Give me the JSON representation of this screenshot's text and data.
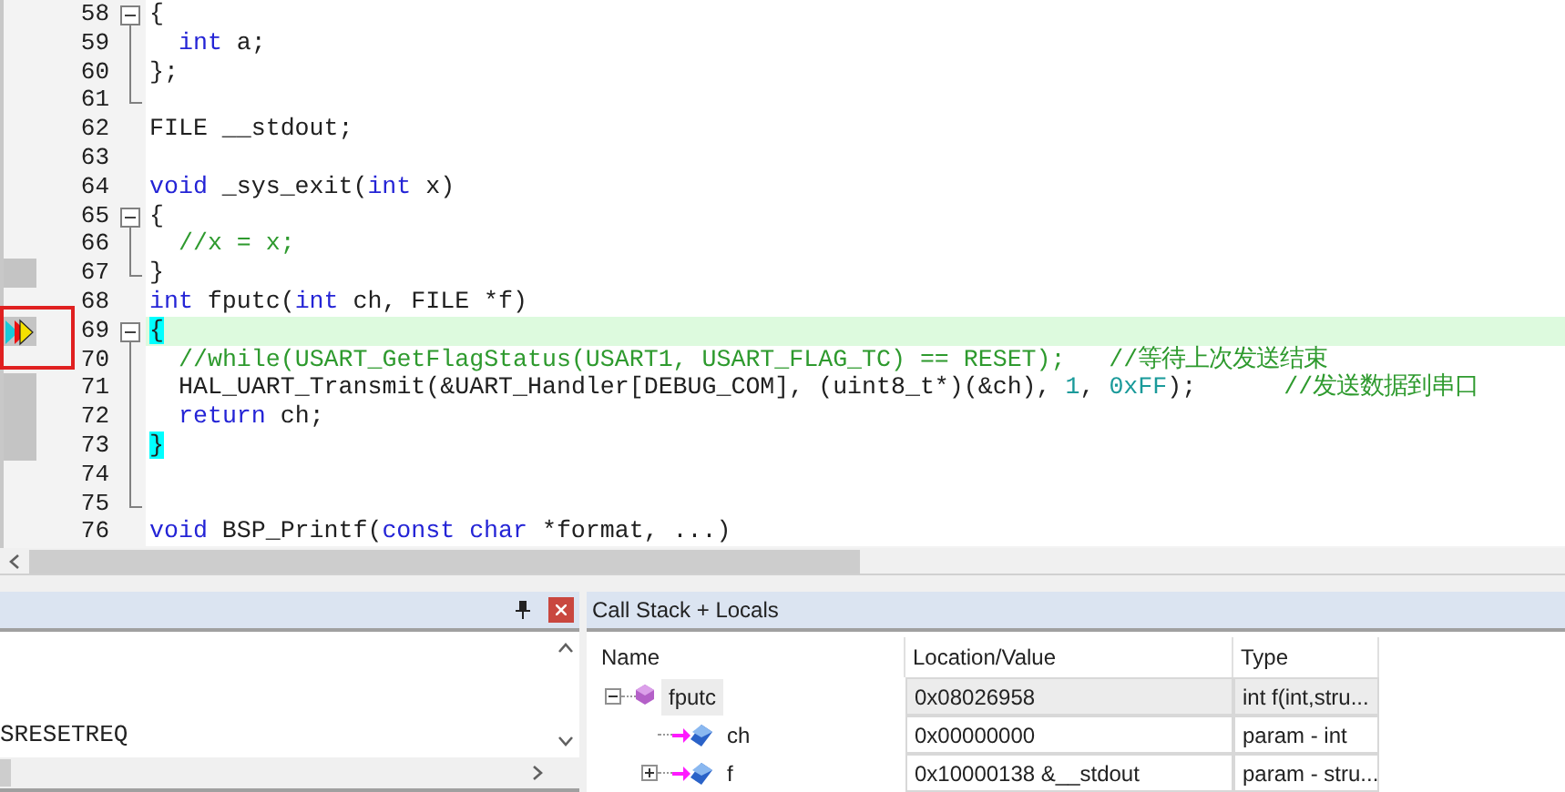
{
  "editor": {
    "lines": [
      {
        "number": "58",
        "kind": "opener",
        "marked": false,
        "current": false,
        "indented": false,
        "segments": [
          {
            "kind": "plain",
            "text": "{"
          }
        ]
      },
      {
        "number": "59",
        "kind": "inner",
        "marked": false,
        "current": false,
        "indented": true,
        "segments": [
          {
            "kind": "keyword",
            "text": "int"
          },
          {
            "kind": "plain",
            "text": " a;"
          }
        ]
      },
      {
        "number": "60",
        "kind": "inner",
        "marked": false,
        "current": false,
        "indented": false,
        "segments": [
          {
            "kind": "plain",
            "text": "};"
          }
        ]
      },
      {
        "number": "61",
        "kind": "closer",
        "marked": false,
        "current": false
      },
      {
        "number": "62",
        "kind": "plain",
        "marked": false,
        "current": false,
        "indented": false,
        "segments": [
          {
            "kind": "plain",
            "text": "FILE __stdout;"
          }
        ]
      },
      {
        "number": "63",
        "kind": "plain",
        "marked": false,
        "current": false
      },
      {
        "number": "64",
        "kind": "plain",
        "marked": false,
        "current": false,
        "indented": false,
        "segments": [
          {
            "kind": "keyword",
            "text": "void"
          },
          {
            "kind": "plain",
            "text": " _sys_exit("
          },
          {
            "kind": "keyword",
            "text": "int"
          },
          {
            "kind": "plain",
            "text": " x)"
          }
        ]
      },
      {
        "number": "65",
        "kind": "opener",
        "marked": false,
        "current": false,
        "indented": false,
        "segments": [
          {
            "kind": "plain",
            "text": "{"
          }
        ]
      },
      {
        "number": "66",
        "kind": "inner",
        "marked": false,
        "current": false,
        "indented": true,
        "segments": [
          {
            "kind": "comment",
            "text": "//x = x;"
          }
        ]
      },
      {
        "number": "67",
        "kind": "closer",
        "marked": true,
        "current": false,
        "indented": false,
        "segments": [
          {
            "kind": "plain",
            "text": "}"
          }
        ]
      },
      {
        "number": "68",
        "kind": "plain",
        "marked": false,
        "current": false,
        "indented": false,
        "segments": [
          {
            "kind": "keyword",
            "text": "int"
          },
          {
            "kind": "plain",
            "text": " fputc("
          },
          {
            "kind": "keyword",
            "text": "int"
          },
          {
            "kind": "plain",
            "text": " ch, FILE *f)"
          }
        ]
      },
      {
        "number": "69",
        "kind": "opener",
        "marked": true,
        "current": true,
        "indented": false,
        "segments": [
          {
            "kind": "brace",
            "text": "{"
          }
        ]
      },
      {
        "number": "70",
        "kind": "inner",
        "marked": false,
        "current": false,
        "indented": true,
        "segments": [
          {
            "kind": "comment",
            "text": "//while(USART_GetFlagStatus(USART1, USART_FLAG_TC) == RESET);   //等待上次发送结束"
          }
        ]
      },
      {
        "number": "71",
        "kind": "inner",
        "marked": true,
        "current": false,
        "indented": true,
        "segments": [
          {
            "kind": "plain",
            "text": "HAL_UART_Transmit(&UART_Handler[DEBUG_COM], (uint8_t*)(&ch), "
          },
          {
            "kind": "number",
            "text": "1"
          },
          {
            "kind": "plain",
            "text": ", "
          },
          {
            "kind": "number",
            "text": "0xFF"
          },
          {
            "kind": "plain",
            "text": ");"
          },
          {
            "kind": "comment",
            "text": "//发送数据到串口"
          }
        ]
      },
      {
        "number": "72",
        "kind": "inner",
        "marked": true,
        "current": false,
        "indented": true,
        "segments": [
          {
            "kind": "keyword",
            "text": "return"
          },
          {
            "kind": "plain",
            "text": " ch;"
          }
        ]
      },
      {
        "number": "73",
        "kind": "inner",
        "marked": true,
        "current": false,
        "indented": false,
        "segments": [
          {
            "kind": "brace",
            "text": "}"
          }
        ]
      },
      {
        "number": "74",
        "kind": "inner",
        "marked": false,
        "current": false
      },
      {
        "number": "75",
        "kind": "closer",
        "marked": false,
        "current": false
      },
      {
        "number": "76",
        "kind": "plain",
        "marked": false,
        "current": false,
        "indented": false,
        "segments": [
          {
            "kind": "keyword",
            "text": "void"
          },
          {
            "kind": "plain",
            "text": " BSP_Printf("
          },
          {
            "kind": "keyword",
            "text": "const char"
          },
          {
            "kind": "plain",
            "text": " *format, ...)"
          }
        ]
      }
    ]
  },
  "output_panel": {
    "lines": [
      "SRESETREQ"
    ]
  },
  "locals_panel": {
    "title": "Call Stack + Locals",
    "columns": [
      "Name",
      "Location/Value",
      "Type"
    ],
    "rows": [
      {
        "name": "fputc",
        "value": "0x08026958",
        "type": "int f(int,stru...",
        "kind": "function",
        "expanded": true,
        "selected": true,
        "children": [
          {
            "name": "ch",
            "value": "0x00000000",
            "type": "param - int",
            "kind": "param",
            "selected": false
          },
          {
            "name": "f",
            "value": "0x10000138 &__stdout",
            "type": "param - stru...",
            "kind": "param",
            "expanded": false,
            "selected": false
          }
        ]
      }
    ]
  }
}
